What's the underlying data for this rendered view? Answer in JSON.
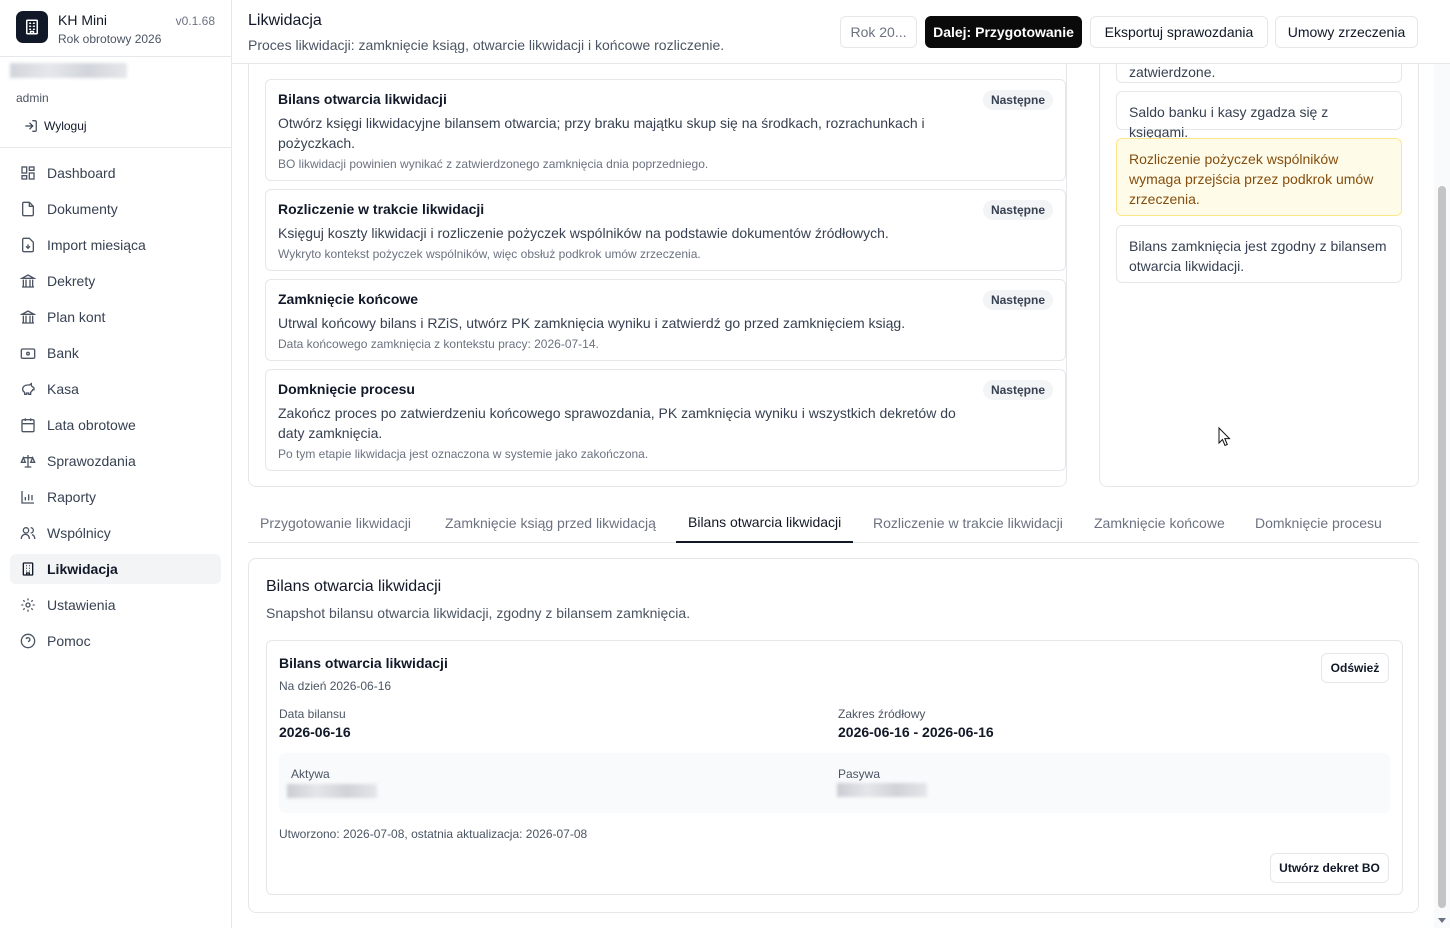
{
  "app": {
    "name": "KH Mini",
    "fiscal_year": "Rok obrotowy 2026",
    "version": "v0.1.68"
  },
  "user": {
    "role": "admin",
    "logout_label": "Wyloguj"
  },
  "nav": [
    {
      "label": "Dashboard",
      "icon": "dashboard-icon"
    },
    {
      "label": "Dokumenty",
      "icon": "document-icon"
    },
    {
      "label": "Import miesiąca",
      "icon": "import-icon"
    },
    {
      "label": "Dekrety",
      "icon": "bank-building-icon"
    },
    {
      "label": "Plan kont",
      "icon": "bank-building-icon"
    },
    {
      "label": "Bank",
      "icon": "wallet-icon"
    },
    {
      "label": "Kasa",
      "icon": "piggy-bank-icon"
    },
    {
      "label": "Lata obrotowe",
      "icon": "calendar-icon"
    },
    {
      "label": "Sprawozdania",
      "icon": "scale-icon"
    },
    {
      "label": "Raporty",
      "icon": "bar-chart-icon"
    },
    {
      "label": "Wspólnicy",
      "icon": "users-icon"
    },
    {
      "label": "Likwidacja",
      "icon": "building-icon",
      "active": true
    },
    {
      "label": "Ustawienia",
      "icon": "gear-icon"
    },
    {
      "label": "Pomoc",
      "icon": "help-icon"
    }
  ],
  "header": {
    "title": "Likwidacja",
    "subtitle": "Proces likwidacji: zamknięcie ksiąg, otwarcie likwidacji i końcowe rozliczenie.",
    "year_button": "Rok 20...",
    "next_button": "Dalej: Przygotowanie",
    "export_button": "Eksportuj sprawozdania",
    "contracts_button": "Umowy zrzeczenia"
  },
  "steps": [
    {
      "title": "Bilans otwarcia likwidacji",
      "badge": "Następne",
      "desc": "Otwórz księgi likwidacyjne bilansem otwarcia; przy braku majątku skup się na środkach, rozrachunkach i pożyczkach.",
      "note": "BO likwidacji powinien wynikać z zatwierdzonego zamknięcia dnia poprzedniego."
    },
    {
      "title": "Rozliczenie w trakcie likwidacji",
      "badge": "Następne",
      "desc": "Księguj koszty likwidacji i rozliczenie pożyczek wspólników na podstawie dokumentów źródłowych.",
      "note": "Wykryto kontekst pożyczek wspólników, więc obsłuż podkrok umów zrzeczenia."
    },
    {
      "title": "Zamknięcie końcowe",
      "badge": "Następne",
      "desc": "Utrwal końcowy bilans i RZiS, utwórz PK zamknięcia wyniku i zatwierdź go przed zamknięciem ksiąg.",
      "note": "Data końcowego zamknięcia z kontekstu pracy: 2026-07-14."
    },
    {
      "title": "Domknięcie procesu",
      "badge": "Następne",
      "desc": "Zakończ proces po zatwierdzeniu końcowego sprawozdania, PK zamknięcia wyniku i wszystkich dekretów do daty zamknięcia.",
      "note": "Po tym etapie likwidacja jest oznaczona w systemie jako zakończona."
    }
  ],
  "checks": [
    {
      "text": "zatwierdzone."
    },
    {
      "text": "Saldo banku i kasy zgadza się z księgami."
    },
    {
      "text": "Rozliczenie pożyczek wspólników wymaga przejścia przez podkrok umów zrzeczenia.",
      "warn": true
    },
    {
      "text": "Bilans zamknięcia jest zgodny z bilansem otwarcia likwidacji."
    }
  ],
  "tabs": [
    {
      "label": "Przygotowanie likwidacji"
    },
    {
      "label": "Zamknięcie ksiąg przed likwidacją"
    },
    {
      "label": "Bilans otwarcia likwidacji",
      "active": true
    },
    {
      "label": "Rozliczenie w trakcie likwidacji"
    },
    {
      "label": "Zamknięcie końcowe"
    },
    {
      "label": "Domknięcie procesu"
    }
  ],
  "detail": {
    "title": "Bilans otwarcia likwidacji",
    "subtitle": "Snapshot bilansu otwarcia likwidacji, zgodny z bilansem zamknięcia.",
    "card_title": "Bilans otwarcia likwidacji",
    "as_of": "Na dzień 2026-06-16",
    "refresh_button": "Odśwież",
    "balance_date_label": "Data bilansu",
    "balance_date": "2026-06-16",
    "source_range_label": "Zakres źródłowy",
    "source_range": "2026-06-16 - 2026-06-16",
    "assets_label": "Aktywa",
    "liabilities_label": "Pasywa",
    "meta": "Utworzono: 2026-07-08, ostatnia aktualizacja: 2026-07-08",
    "create_button": "Utwórz dekret BO"
  }
}
